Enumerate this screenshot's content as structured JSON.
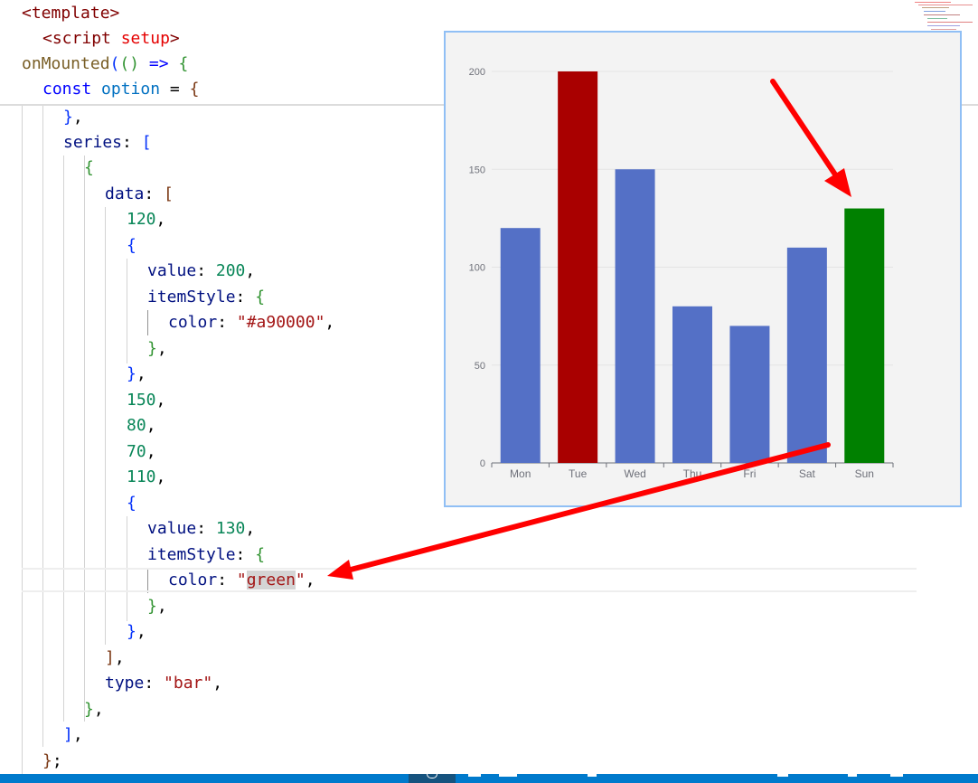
{
  "sticky_header": [
    {
      "tokens": [
        [
          "<",
          "tk-tag"
        ],
        [
          "template",
          "tk-tag"
        ],
        [
          ">",
          "tk-tag"
        ]
      ]
    },
    {
      "tokens": [
        [
          "<",
          "tk-tag"
        ],
        [
          "script",
          "tk-tag"
        ],
        [
          " ",
          "tk-p"
        ],
        [
          "setup",
          "tk-attr"
        ],
        [
          ">",
          "tk-tag"
        ]
      ]
    },
    {
      "tokens": [
        [
          "onMounted",
          "tk-fn"
        ],
        [
          "(",
          "b1"
        ],
        [
          "()",
          "b2"
        ],
        [
          " ",
          "tk-p"
        ],
        [
          "=>",
          "tk-kw"
        ],
        [
          " ",
          "tk-p"
        ],
        [
          "{",
          "b2"
        ]
      ]
    },
    {
      "tokens": [
        [
          "const",
          "tk-kw"
        ],
        [
          " ",
          "tk-p"
        ],
        [
          "option",
          "tk-var"
        ],
        [
          " = ",
          "tk-p"
        ],
        [
          "{",
          "b3"
        ]
      ]
    }
  ],
  "code_lines": [
    {
      "tokens": [
        [
          "}",
          "b1"
        ],
        [
          ",",
          "tk-p"
        ]
      ]
    },
    {
      "tokens": [
        [
          "series",
          "tk-prop"
        ],
        [
          ": ",
          "tk-p"
        ],
        [
          "[",
          "b1"
        ]
      ]
    },
    {
      "tokens": [
        [
          "{",
          "b2"
        ]
      ]
    },
    {
      "tokens": [
        [
          "data",
          "tk-prop"
        ],
        [
          ": ",
          "tk-p"
        ],
        [
          "[",
          "b3"
        ]
      ]
    },
    {
      "tokens": [
        [
          "120",
          "tk-num"
        ],
        [
          ",",
          "tk-p"
        ]
      ]
    },
    {
      "tokens": [
        [
          "{",
          "b1"
        ]
      ]
    },
    {
      "tokens": [
        [
          "value",
          "tk-prop"
        ],
        [
          ": ",
          "tk-p"
        ],
        [
          "200",
          "tk-num"
        ],
        [
          ",",
          "tk-p"
        ]
      ]
    },
    {
      "tokens": [
        [
          "itemStyle",
          "tk-prop"
        ],
        [
          ": ",
          "tk-p"
        ],
        [
          "{",
          "b2"
        ]
      ]
    },
    {
      "tokens": [
        [
          "color",
          "tk-prop"
        ],
        [
          ": ",
          "tk-p"
        ],
        [
          "\"#a90000\"",
          "tk-str"
        ],
        [
          ",",
          "tk-p"
        ]
      ]
    },
    {
      "tokens": [
        [
          "}",
          "b2"
        ],
        [
          ",",
          "tk-p"
        ]
      ]
    },
    {
      "tokens": [
        [
          "}",
          "b1"
        ],
        [
          ",",
          "tk-p"
        ]
      ]
    },
    {
      "tokens": [
        [
          "150",
          "tk-num"
        ],
        [
          ",",
          "tk-p"
        ]
      ]
    },
    {
      "tokens": [
        [
          "80",
          "tk-num"
        ],
        [
          ",",
          "tk-p"
        ]
      ]
    },
    {
      "tokens": [
        [
          "70",
          "tk-num"
        ],
        [
          ",",
          "tk-p"
        ]
      ]
    },
    {
      "tokens": [
        [
          "110",
          "tk-num"
        ],
        [
          ",",
          "tk-p"
        ]
      ]
    },
    {
      "tokens": [
        [
          "{",
          "b1"
        ]
      ]
    },
    {
      "tokens": [
        [
          "value",
          "tk-prop"
        ],
        [
          ": ",
          "tk-p"
        ],
        [
          "130",
          "tk-num"
        ],
        [
          ",",
          "tk-p"
        ]
      ]
    },
    {
      "tokens": [
        [
          "itemStyle",
          "tk-prop"
        ],
        [
          ": ",
          "tk-p"
        ],
        [
          "{",
          "b2"
        ]
      ]
    },
    {
      "tokens": [
        [
          "color",
          "tk-prop"
        ],
        [
          ": ",
          "tk-p"
        ],
        [
          "\"",
          "tk-str"
        ],
        [
          "green",
          "tk-str sel"
        ],
        [
          "\"",
          "tk-str"
        ],
        [
          ",",
          "tk-p"
        ]
      ]
    },
    {
      "tokens": [
        [
          "}",
          "b2"
        ],
        [
          ",",
          "tk-p"
        ]
      ]
    },
    {
      "tokens": [
        [
          "}",
          "b1"
        ],
        [
          ",",
          "tk-p"
        ]
      ]
    },
    {
      "tokens": [
        [
          "]",
          "b3"
        ],
        [
          ",",
          "tk-p"
        ]
      ]
    },
    {
      "tokens": [
        [
          "type",
          "tk-prop"
        ],
        [
          ": ",
          "tk-p"
        ],
        [
          "\"bar\"",
          "tk-str"
        ],
        [
          ",",
          "tk-p"
        ]
      ]
    },
    {
      "tokens": [
        [
          "}",
          "b2"
        ],
        [
          ",",
          "tk-p"
        ]
      ]
    },
    {
      "tokens": [
        [
          "]",
          "b1"
        ],
        [
          ",",
          "tk-p"
        ]
      ]
    },
    {
      "tokens": [
        [
          "}",
          "b3"
        ],
        [
          ";",
          "tk-p"
        ]
      ]
    }
  ],
  "colors": {
    "bar_default": "#5470c6",
    "bar_tue": "#a90000",
    "bar_sun": "#008000",
    "arrow": "#ff0000",
    "status_bar": "#007acc"
  },
  "chart_data": {
    "type": "bar",
    "categories": [
      "Mon",
      "Tue",
      "Wed",
      "Thu",
      "Fri",
      "Sat",
      "Sun"
    ],
    "values": [
      120,
      200,
      150,
      80,
      70,
      110,
      130
    ],
    "bar_colors": [
      "#5470c6",
      "#a90000",
      "#5470c6",
      "#5470c6",
      "#5470c6",
      "#5470c6",
      "#008000"
    ],
    "ylim": [
      0,
      200
    ],
    "yticks": [
      0,
      50,
      100,
      150,
      200
    ],
    "title": "",
    "xlabel": "",
    "ylabel": "",
    "grid": true
  }
}
